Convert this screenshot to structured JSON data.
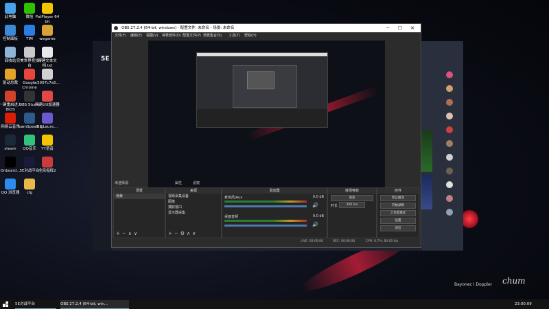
{
  "desktop_icons": [
    {
      "label": "此电脑",
      "icon": "computer-icon",
      "color": "#4aa3e8"
    },
    {
      "label": "微信",
      "icon": "wechat-icon",
      "color": "#2dc100"
    },
    {
      "label": "PotPlayer 64 bit",
      "icon": "potplayer-icon",
      "color": "#f5c400"
    },
    {
      "label": "控制面板",
      "icon": "control-panel-icon",
      "color": "#3c8ad6"
    },
    {
      "label": "TIM",
      "icon": "tim-icon",
      "color": "#2a7de1"
    },
    {
      "label": "wegame",
      "icon": "wegame-icon",
      "color": "#d7a23a"
    },
    {
      "label": "回收站",
      "icon": "recycle-bin-icon",
      "color": "#8fb4d8"
    },
    {
      "label": "完美世界竞技平台",
      "icon": "perfect-world-icon",
      "color": "#c9c9c9"
    },
    {
      "label": "新建文本文档.txt",
      "icon": "text-file-icon",
      "color": "#e8e8e8"
    },
    {
      "label": "驱动总裁",
      "icon": "driver-icon",
      "color": "#e2a527"
    },
    {
      "label": "Google Chrome",
      "icon": "chrome-icon",
      "color": "#e8453c"
    },
    {
      "label": "c5007c7a5...",
      "icon": "document-icon",
      "color": "#d0d0d0"
    },
    {
      "label": "一键重启进入BIOS",
      "icon": "bios-icon",
      "color": "#d0432b"
    },
    {
      "label": "OBS Studio",
      "icon": "obs-icon",
      "color": "#333333"
    },
    {
      "label": "网易UU加速器",
      "icon": "uu-icon",
      "color": "#e04848"
    },
    {
      "label": "网易云音乐",
      "icon": "netease-music-icon",
      "color": "#d81e06"
    },
    {
      "label": "TeamSpeak 3",
      "icon": "teamspeak-icon",
      "color": "#2d5a8b"
    },
    {
      "label": "BigLaunc...",
      "icon": "launcher-icon",
      "color": "#6a5acd"
    },
    {
      "label": "steam",
      "icon": "steam-icon",
      "color": "#1b2838"
    },
    {
      "label": "QQ音乐",
      "icon": "qq-music-icon",
      "color": "#31c27c"
    },
    {
      "label": "YY语音",
      "icon": "yy-icon",
      "color": "#f5c400"
    },
    {
      "label": "Onboard...",
      "icon": "logitech-icon",
      "color": "#000000"
    },
    {
      "label": "5E对战平台",
      "icon": "5e-icon",
      "color": "#1a1a3a"
    },
    {
      "label": "全民指挥2",
      "icon": "game-icon",
      "color": "#c83c3c"
    },
    {
      "label": "QQ 浏览器",
      "icon": "qq-browser-icon",
      "color": "#2b8ced"
    },
    {
      "label": "cfg",
      "icon": "folder-icon",
      "color": "#e8b84a"
    }
  ],
  "obs": {
    "title": "OBS 27.2.4 (64-bit, windows) - 配置文件: 未命名 - 场景: 未命名",
    "menu": [
      "文件(F)",
      "编辑(E)",
      "视图(V)",
      "停靠部件(D)",
      "配置文件(P)",
      "场景集合(S)",
      "工具(T)",
      "帮助(H)"
    ],
    "scene_label": "未选择源",
    "scene_buttons": [
      "属性",
      "滤镜"
    ],
    "docks": {
      "scenes": {
        "title": "场景",
        "items": [
          "场景"
        ]
      },
      "sources": {
        "title": "来源",
        "items": [
          "视频采集设备",
          "图像",
          "捕获窗口",
          "显示器采集"
        ]
      },
      "mixer": {
        "title": "混音器",
        "channels": [
          {
            "name": "麦克风/Aux",
            "db": "0.0 dB"
          },
          {
            "name": "桌面音频",
            "db": "0.0 dB"
          }
        ]
      },
      "transitions": {
        "title": "转场特效",
        "type": "渐变",
        "duration_label": "时长",
        "duration": "300 ms"
      },
      "controls": {
        "title": "控件",
        "buttons": [
          "停止推流",
          "开始录制",
          "工作室模式",
          "设置",
          "退出"
        ]
      }
    },
    "status": {
      "live": "LIVE: 00:00:00",
      "rec": "REC: 00:00:00",
      "cpu": "CPU: 0.7%, 60.00 fps"
    }
  },
  "bg_app": {
    "name": "5E"
  },
  "taskbar": {
    "items": [
      "5E对战平台",
      "OBS 27.2.4 (64-bit, win..."
    ],
    "time": "23:00:09"
  },
  "wallpaper": {
    "credit": "Bayonec I Doppler",
    "signature": "chum"
  },
  "colors": {
    "accent": "#d22a3a",
    "obs_bg": "#2c2c2c",
    "taskbar": "#141414"
  }
}
